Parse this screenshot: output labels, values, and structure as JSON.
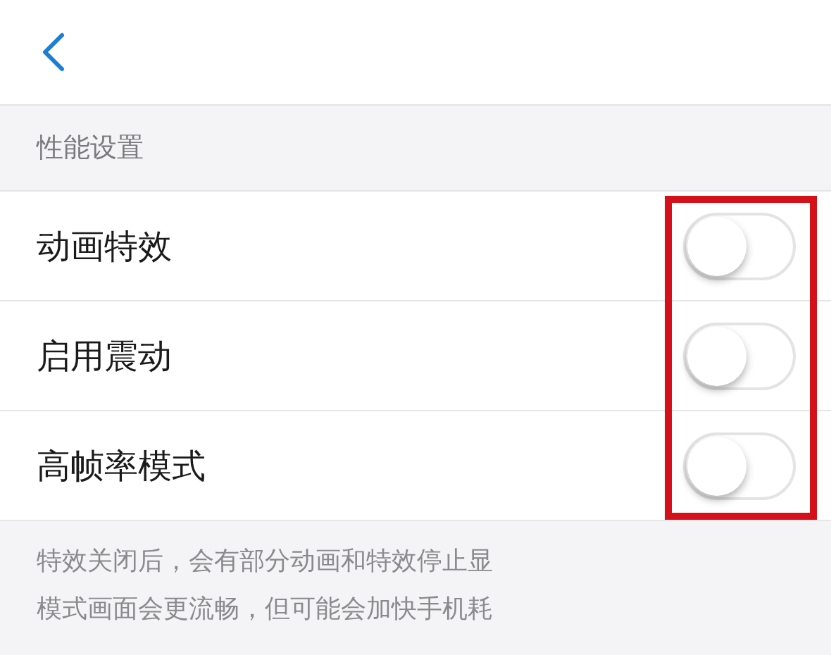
{
  "header": {
    "back": true
  },
  "section": {
    "title": "性能设置"
  },
  "settings": [
    {
      "label": "动画特效",
      "on": false
    },
    {
      "label": "启用震动",
      "on": false
    },
    {
      "label": "高帧率模式",
      "on": false
    }
  ],
  "toggles_highlighted": true,
  "footer": {
    "lines": [
      "特效关闭后，会有部分动画和特效停止显",
      "模式画面会更流畅，但可能会加快手机耗"
    ]
  }
}
